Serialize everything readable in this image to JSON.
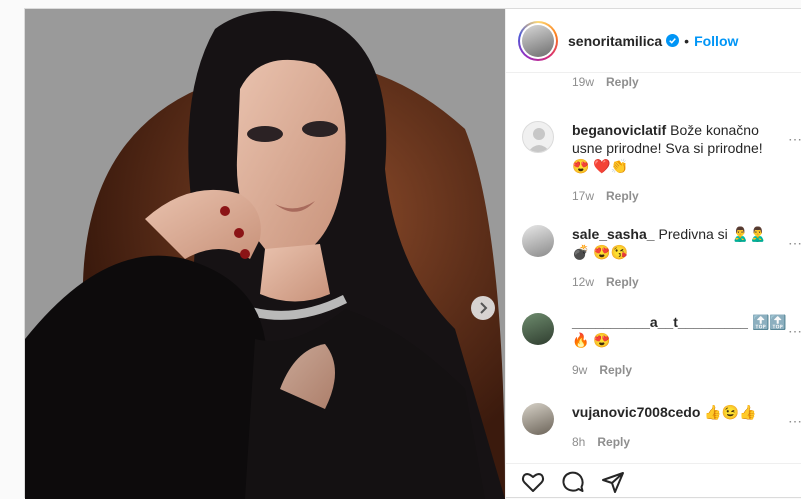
{
  "header": {
    "username": "senoritamilica",
    "separator": "•",
    "follow_label": "Follow"
  },
  "top_meta": {
    "time": "19w",
    "reply": "Reply"
  },
  "comments": [
    {
      "user": "beganoviclatif",
      "text": "Bože konačno usne prirodne! Sva si prirodne!😍 ❤️👏",
      "time": "17w",
      "reply": "Reply"
    },
    {
      "user": "sale_sasha_",
      "text": "Predivna si 🙎‍♂️🙎‍♂️💣 😍😘",
      "time": "12w",
      "reply": "Reply"
    },
    {
      "user": "__________a__t_________",
      "text": "🔝🔝🔥 😍",
      "time": "9w",
      "reply": "Reply"
    },
    {
      "user": "vujanovic7008cedo",
      "text": "👍😉👍",
      "time": "8h",
      "reply": "Reply"
    }
  ],
  "colors": {
    "accent": "#0095f6",
    "muted": "#8e8e8e",
    "border": "#dbdbdb"
  },
  "icons": [
    "verified-badge-icon",
    "chevron-right-icon",
    "heart-icon",
    "comment-icon",
    "share-icon",
    "more-options-icon"
  ]
}
